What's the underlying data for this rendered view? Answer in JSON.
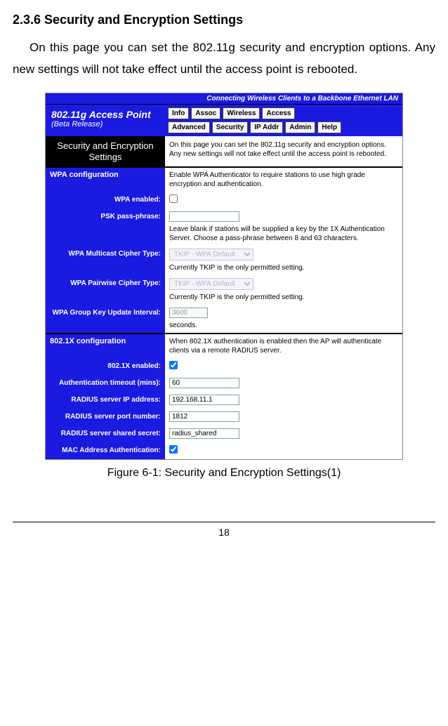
{
  "doc": {
    "section_heading": "2.3.6  Security and Encryption Settings",
    "intro": "On this page you can set the 802.11g security and encryption options. Any new settings will not take effect until the access point is rebooted.",
    "caption": "Figure 6-1: Security and Encryption Settings(1)",
    "page_number": "18"
  },
  "ui": {
    "banner": "Connecting Wireless Clients to a Backbone Ethernet LAN",
    "product_title": "802.11g Access Point",
    "product_sub": "(Beta Release)",
    "tabs_row1": [
      "Info",
      "Assoc",
      "Wireless",
      "Access"
    ],
    "tabs_row2": [
      "Advanced",
      "Security",
      "IP Addr",
      "Admin",
      "Help"
    ],
    "settings_title": "Security and Encryption Settings",
    "settings_desc": "On this page you can set the 802.11g security and encryption options. Any new settings will not take effect until the access point is rebooted.",
    "wpa": {
      "section_title": "WPA configuration",
      "section_desc": "Enable WPA Authenticator to require stations to use high grade encryption and authentication.",
      "enabled_label": "WPA enabled:",
      "psk_label": "PSK pass-phrase:",
      "psk_value": "",
      "psk_help": "Leave blank if stations will be supplied a key by the 1X Authentication Server. Choose a pass-phrase between 8 and 63 characters.",
      "mcast_label": "WPA Multicast Cipher Type:",
      "mcast_option": "TKIP - WPA Default",
      "mcast_help": "Currently TKIP is the only permitted setting.",
      "pairwise_label": "WPA Pairwise Cipher Type:",
      "pairwise_option": "TKIP - WPA Default",
      "pairwise_help": "Currently TKIP is the only permitted setting.",
      "gkupdate_label": "WPA Group Key Update Interval:",
      "gkupdate_value": "3600",
      "gkupdate_help": "seconds."
    },
    "dot1x": {
      "section_title": "802.1X configuration",
      "section_desc": "When 802.1X authentication is enabled then the AP will authenticate clients via a remote RADIUS server.",
      "enabled_label": "802.1X enabled:",
      "auth_timeout_label": "Authentication timeout (mins):",
      "auth_timeout_value": "60",
      "radius_ip_label": "RADIUS server IP address:",
      "radius_ip_value": "192.168.11.1",
      "radius_port_label": "RADIUS server port number:",
      "radius_port_value": "1812",
      "radius_secret_label": "RADIUS server shared secret:",
      "radius_secret_value": "radius_shared",
      "mac_auth_label": "MAC Address Authentication:"
    }
  }
}
